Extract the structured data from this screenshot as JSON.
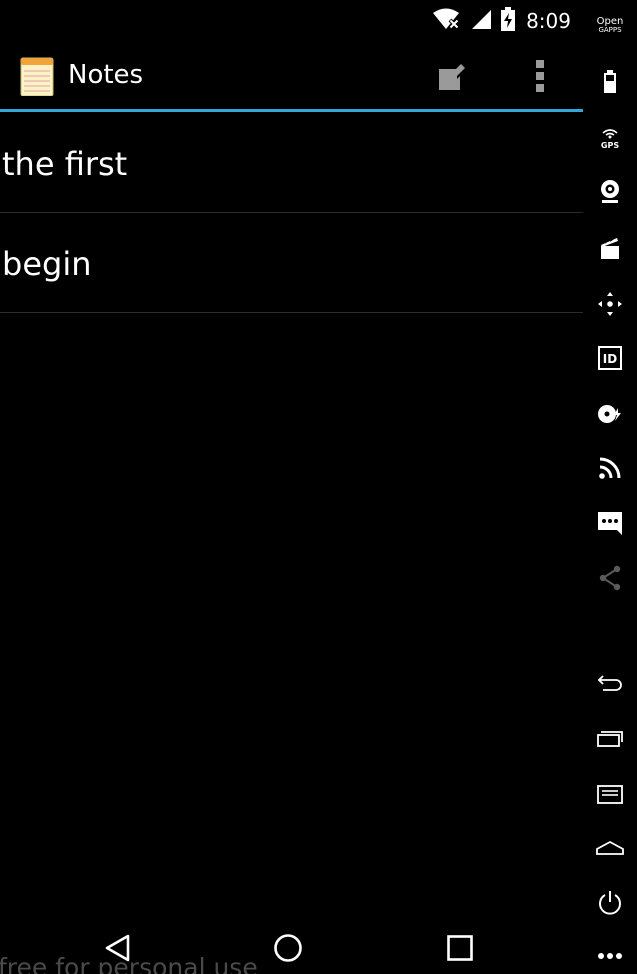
{
  "status_bar": {
    "time": "8:09",
    "icons": [
      "wifi-no-internet-icon",
      "cell-signal-icon",
      "battery-charging-icon"
    ]
  },
  "action_bar": {
    "app_title": "Notes",
    "app_icon": "notepad-icon",
    "new_note_icon": "new-note-icon",
    "overflow_icon": "overflow-menu-icon",
    "accent_color": "#33a7d8"
  },
  "notes": [
    {
      "title": "the first"
    },
    {
      "title": "begin"
    }
  ],
  "nav_bar": {
    "icons": [
      "back-icon",
      "home-icon",
      "recents-icon"
    ]
  },
  "watermark": "free for personal use",
  "sidebar": {
    "brand_line1": "Open",
    "brand_line2": "GAPPS",
    "items": [
      "battery-icon",
      "gps-icon",
      "webcam-icon",
      "screencast-icon",
      "dpad-icon",
      "device-id-icon",
      "disk-icon",
      "cast-icon",
      "sms-icon",
      "share-icon",
      "back-icon",
      "recents-icon",
      "menu-icon",
      "home-icon",
      "power-icon",
      "more-icon"
    ]
  }
}
